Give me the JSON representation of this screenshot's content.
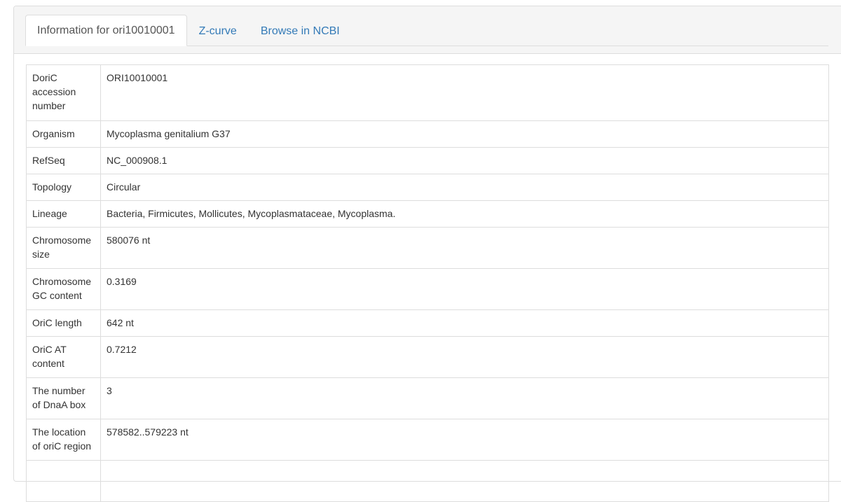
{
  "tabs": [
    {
      "label": "Information for ori10010001",
      "active": true
    },
    {
      "label": "Z-curve",
      "active": false
    },
    {
      "label": "Browse in NCBI",
      "active": false
    }
  ],
  "table": {
    "rows": [
      {
        "label": "DoriC accession number",
        "value": "ORI10010001"
      },
      {
        "label": "Organism",
        "value": "Mycoplasma genitalium G37"
      },
      {
        "label": "RefSeq",
        "value": "NC_000908.1"
      },
      {
        "label": "Topology",
        "value": "Circular"
      },
      {
        "label": "Lineage",
        "value": "Bacteria, Firmicutes, Mollicutes, Mycoplasmataceae, Mycoplasma."
      },
      {
        "label": "Chromosome size",
        "value": "580076 nt"
      },
      {
        "label": "Chromosome GC content",
        "value": "0.3169"
      },
      {
        "label": "OriC length",
        "value": "642 nt"
      },
      {
        "label": "OriC AT content",
        "value": "0.7212"
      },
      {
        "label": "The number of DnaA box",
        "value": "3"
      },
      {
        "label": "The location of oriC region",
        "value": "578582..579223 nt"
      },
      {
        "label": "",
        "value": ""
      }
    ]
  },
  "colors": {
    "link": "#337ab7",
    "border": "#dddddd",
    "heading_bg": "#f5f5f5",
    "text": "#333333"
  }
}
